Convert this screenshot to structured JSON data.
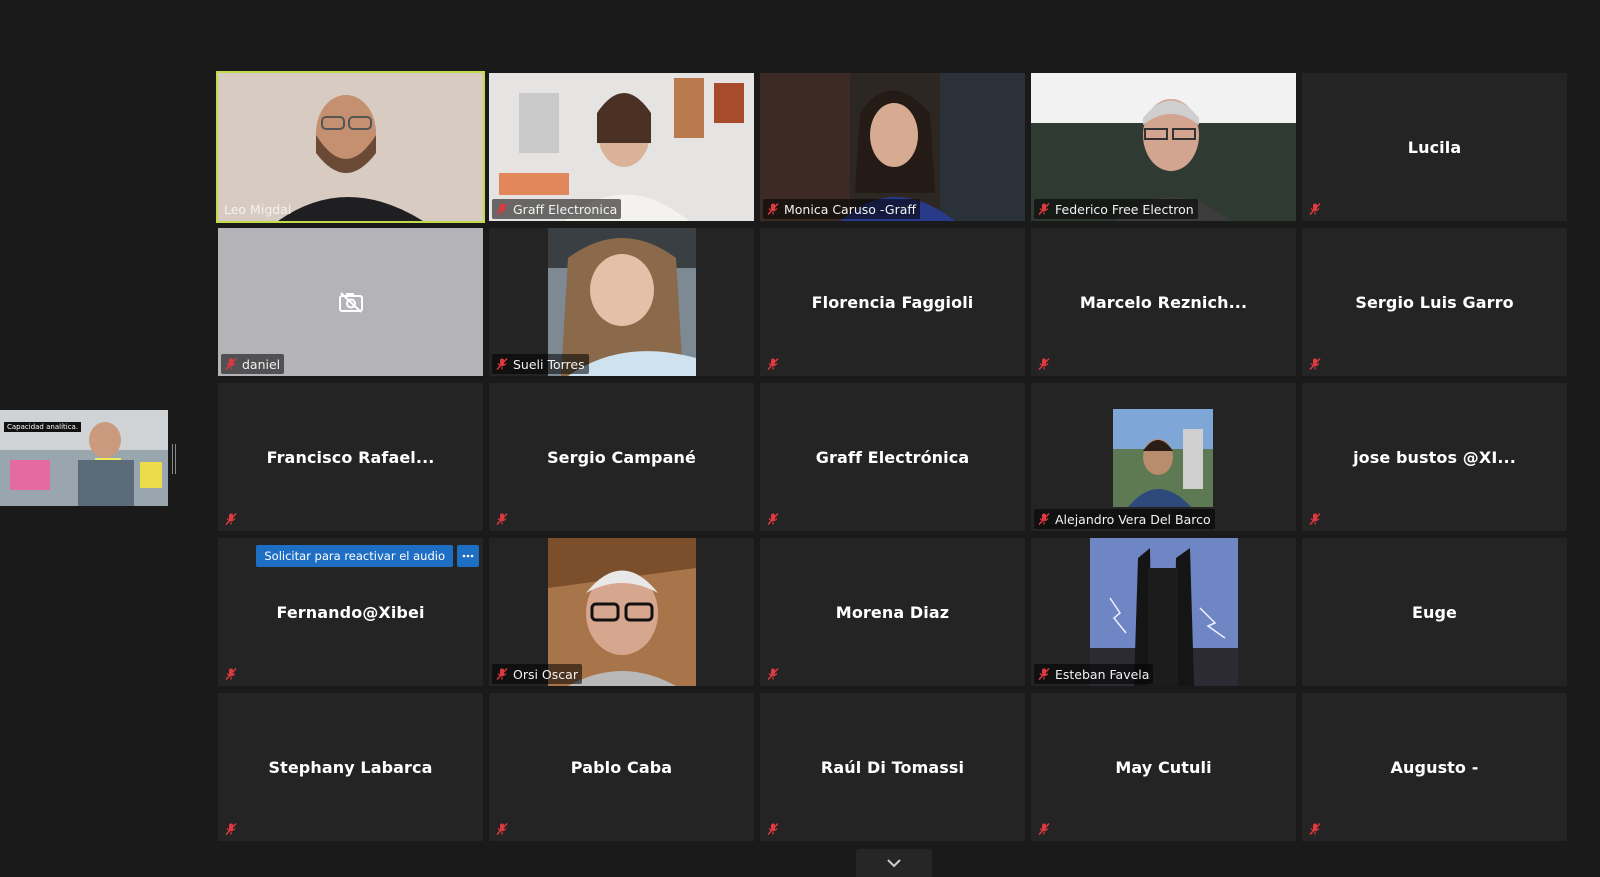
{
  "colors": {
    "background": "#1a1a1a",
    "tile": "#242424",
    "active_speaker_border": "#c3dc4a",
    "muted_icon": "#e0393e",
    "button_blue": "#1e6fc4"
  },
  "self_view": {
    "caption": "Capacidad analítica."
  },
  "unmute_request": {
    "label": "Solicitar para reactivar el audio",
    "more_icon": "ellipsis-icon"
  },
  "participants": [
    {
      "name": "Leo Migdal",
      "video": true,
      "muted": false,
      "active": true
    },
    {
      "name": "Graff Electronica",
      "video": true,
      "muted": true
    },
    {
      "name": "Monica Caruso -Graff",
      "video": true,
      "muted": true
    },
    {
      "name": "Federico Free Electron",
      "video": true,
      "muted": true
    },
    {
      "name": "Lucila",
      "video": false,
      "muted": true
    },
    {
      "name": "daniel",
      "video": false,
      "camera_off_icon": "camera-off-icon",
      "muted": true
    },
    {
      "name": "Sueli Torres",
      "video": true,
      "muted": true
    },
    {
      "name": "Florencia Faggioli",
      "video": false,
      "muted": true
    },
    {
      "name": "Marcelo Reznich...",
      "video": false,
      "muted": true
    },
    {
      "name": "Sergio Luis Garro",
      "video": false,
      "muted": true
    },
    {
      "name": "Francisco Rafael...",
      "video": false,
      "muted": true
    },
    {
      "name": "Sergio Campané",
      "video": false,
      "muted": true
    },
    {
      "name": "Graff Electrónica",
      "video": false,
      "muted": true
    },
    {
      "name": "Alejandro Vera Del Barco",
      "video": true,
      "muted": true
    },
    {
      "name": "jose bustos @XI...",
      "video": false,
      "muted": true
    },
    {
      "name": "Fernando@Xibei",
      "video": false,
      "muted": true
    },
    {
      "name": "Orsi Oscar",
      "video": true,
      "muted": true
    },
    {
      "name": "Morena Diaz",
      "video": false,
      "muted": true
    },
    {
      "name": "Esteban Favela",
      "video": true,
      "muted": true
    },
    {
      "name": "Euge",
      "video": false,
      "muted": false
    },
    {
      "name": "Stephany Labarca",
      "video": false,
      "muted": true
    },
    {
      "name": "Pablo Caba",
      "video": false,
      "muted": true
    },
    {
      "name": "Raúl Di Tomassi",
      "video": false,
      "muted": true
    },
    {
      "name": "May Cutuli",
      "video": false,
      "muted": true
    },
    {
      "name": "Augusto -",
      "video": false,
      "muted": true
    }
  ],
  "scroll_down_icon": "chevron-down-icon"
}
